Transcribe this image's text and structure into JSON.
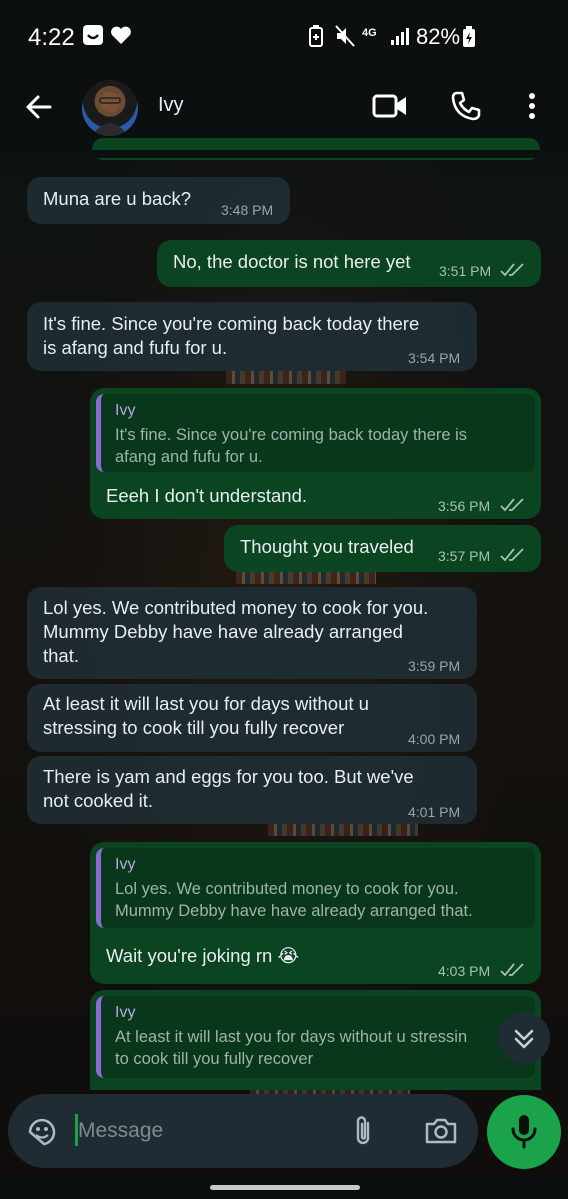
{
  "status_bar": {
    "time": "4:22",
    "battery": "82%",
    "network": "4G"
  },
  "header": {
    "contact_name": "Ivy"
  },
  "messages": [
    {
      "dir": "in",
      "text": "Muna are u back?",
      "time": "3:48 PM"
    },
    {
      "dir": "out",
      "text": "No, the doctor is not here yet",
      "time": "3:51 PM"
    },
    {
      "dir": "in",
      "line1": "It's fine. Since you're coming back today there",
      "line2": "is afang and fufu for u.",
      "time": "3:54 PM"
    },
    {
      "dir": "out",
      "quote_name": "Ivy",
      "quote_line1": "It's fine. Since you're coming back today there is",
      "quote_line2": "afang and fufu for u.",
      "text": "Eeeh I don't understand.",
      "time": "3:56 PM"
    },
    {
      "dir": "out",
      "text": "Thought you traveled",
      "time": "3:57 PM"
    },
    {
      "dir": "in",
      "line1": "Lol yes. We contributed money to cook for you.",
      "line2": "Mummy Debby have have already arranged",
      "line3": "that.",
      "time": "3:59 PM"
    },
    {
      "dir": "in",
      "line1": "At least it will last you for days without u",
      "line2": "stressing to cook till you fully recover",
      "time": "4:00 PM"
    },
    {
      "dir": "in",
      "line1": "There is yam and eggs for you too. But we've",
      "line2": "not cooked it.",
      "time": "4:01 PM"
    },
    {
      "dir": "out",
      "quote_name": "Ivy",
      "quote_line1": "Lol yes. We contributed money to cook for you.",
      "quote_line2": "Mummy Debby have have already arranged that.",
      "text": "Wait you're joking rn 😭",
      "time": "4:03 PM"
    },
    {
      "dir": "out",
      "quote_name": "Ivy",
      "quote_line1": "At least it will last you for days without u stressin",
      "quote_line2": "to cook till you fully recover"
    }
  ],
  "input": {
    "placeholder": "Message"
  },
  "colors": {
    "incoming": "#1f2c33",
    "outgoing": "#0a4722",
    "accent": "#1aa34a",
    "quote_bar": "#8a6cd1"
  },
  "icons": [
    "back-arrow-icon",
    "video-call-icon",
    "voice-call-icon",
    "more-options-icon",
    "sticker-icon",
    "attach-icon",
    "camera-icon",
    "mic-icon",
    "scroll-down-icon"
  ]
}
